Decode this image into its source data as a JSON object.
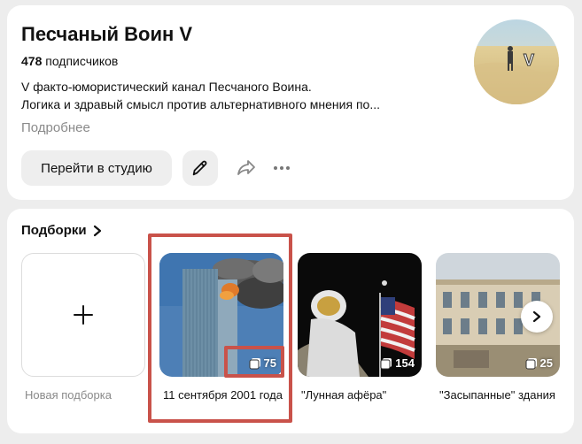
{
  "channel": {
    "title": "Песчаный Воин V",
    "subscribers_count": "478",
    "subscribers_label": "подписчиков",
    "description_line1": "V факто-юмористический канал Песчаного Воина.",
    "description_line2": "Логика и здравый смысл против альтернативного мнения по...",
    "more_label": "Подробнее",
    "studio_button": "Перейти в студию",
    "avatar_letter": "V"
  },
  "collections": {
    "header": "Подборки",
    "new_label": "Новая подборка",
    "items": [
      {
        "title": "11 сентября 2001 года",
        "count": "75"
      },
      {
        "title": "\"Лунная афёра\"",
        "count": "154"
      },
      {
        "title": "\"Засыпанные\" здания",
        "count": "25"
      }
    ]
  },
  "colors": {
    "highlight": "#c9524a",
    "muted_text": "#8a8a8a",
    "button_bg": "#eeeeee"
  }
}
